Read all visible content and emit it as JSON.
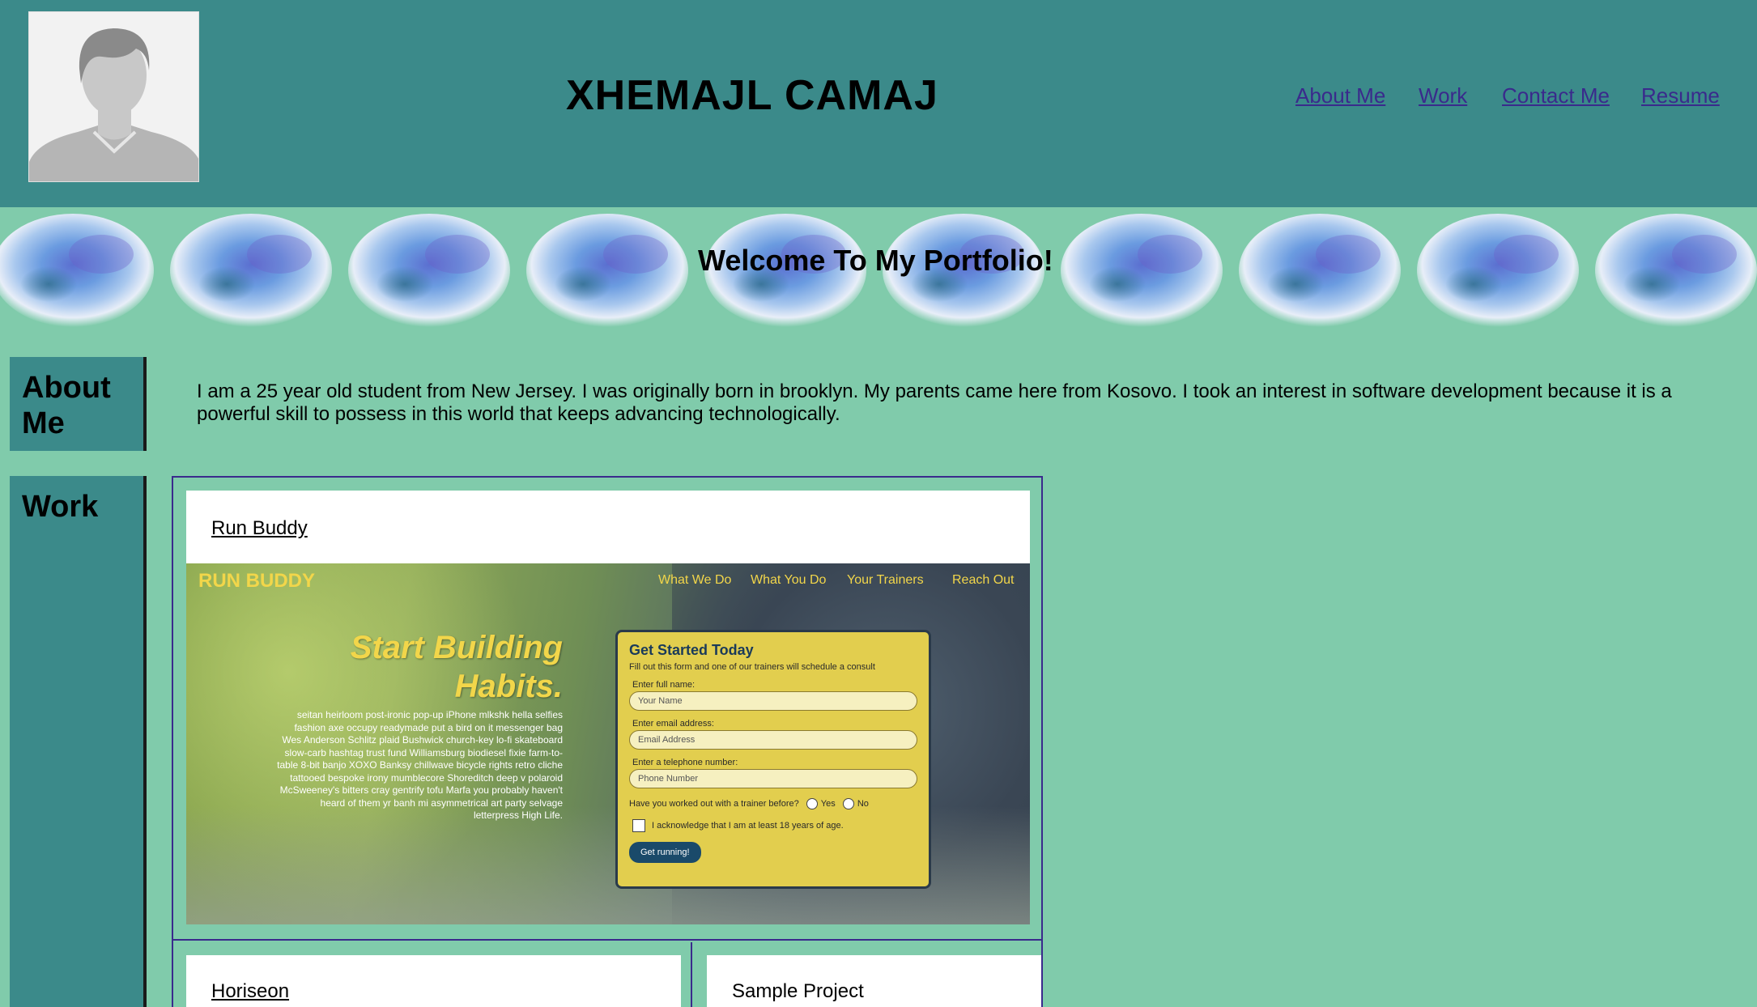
{
  "header": {
    "title": "XHEMAJL CAMAJ",
    "nav": [
      {
        "label": "About Me"
      },
      {
        "label": "Work"
      },
      {
        "label": "Contact Me"
      },
      {
        "label": "Resume"
      }
    ]
  },
  "banner": {
    "title": "Welcome To My Portfolio!"
  },
  "about": {
    "heading": "About Me",
    "text": "I am a 25 year old student from New Jersey. I was originally born in brooklyn. My parents came here from Kosovo. I took an interest in software development because it is a powerful skill to possess in this world that keeps advancing technologically."
  },
  "work": {
    "heading": "Work",
    "projects": [
      {
        "title": "Run Buddy",
        "screenshot": {
          "logo": "RUN BUDDY",
          "nav": [
            "What We Do",
            "What You Do",
            "Your Trainers",
            "Reach Out"
          ],
          "hero": "Start Building Habits.",
          "lorem": "seitan heirloom post-ironic pop-up iPhone mlkshk hella selfies fashion axe occupy readymade put a bird on it messenger bag Wes Anderson Schlitz plaid Bushwick church-key lo-fi skateboard slow-carb hashtag trust fund Williamsburg biodiesel fixie farm-to-table 8-bit banjo XOXO Banksy chillwave bicycle rights retro cliche tattooed bespoke irony mumblecore Shoreditch deep v polaroid McSweeney's bitters cray gentrify tofu Marfa you probably haven't heard of them yr banh mi asymmetrical art party selvage letterpress High Life.",
          "form": {
            "title": "Get Started Today",
            "subtitle": "Fill out this form and one of our trainers will schedule a consult",
            "name_label": "Enter full name:",
            "name_placeholder": "Your Name",
            "email_label": "Enter email address:",
            "email_placeholder": "Email Address",
            "phone_label": "Enter a telephone number:",
            "phone_placeholder": "Phone Number",
            "question": "Have you worked out with a trainer before?",
            "yes": "Yes",
            "no": "No",
            "acknowledge": "I acknowledge that I am at least 18 years of age.",
            "button": "Get running!"
          }
        }
      },
      {
        "title": "Horiseon"
      },
      {
        "title": "Sample Project"
      }
    ]
  }
}
